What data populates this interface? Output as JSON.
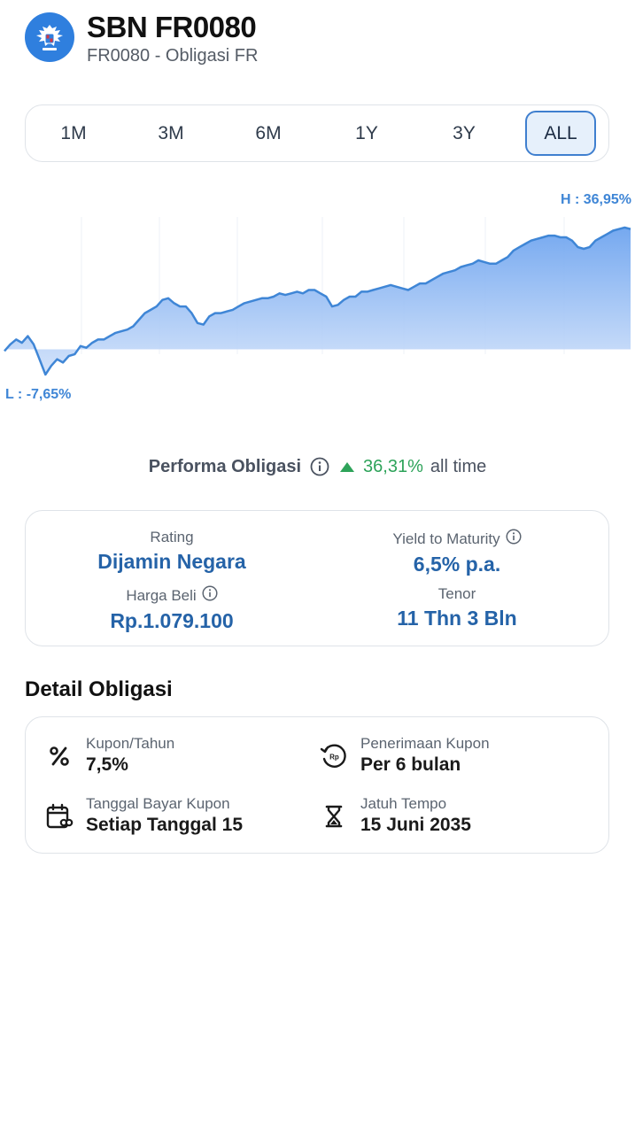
{
  "header": {
    "title": "SBN FR0080",
    "subtitle": "FR0080 - Obligasi FR",
    "logo_icon": "garuda-emblem-icon"
  },
  "timeframes": {
    "items": [
      "1M",
      "3M",
      "6M",
      "1Y",
      "3Y",
      "ALL"
    ],
    "selected": "ALL"
  },
  "chart_data": {
    "type": "area",
    "high_label": "H : 36,95%",
    "low_label": "L : -7,65%",
    "ylim": [
      -7.65,
      36.95
    ],
    "color": "#3f86d6",
    "values": [
      -0.5,
      1.5,
      3,
      2,
      4,
      1.5,
      -3,
      -7.65,
      -5,
      -3,
      -4,
      -2,
      -1.5,
      1,
      0.5,
      2,
      3,
      3,
      4,
      5,
      5.5,
      6,
      7,
      9,
      11,
      12,
      13,
      15,
      15.5,
      14,
      13,
      13,
      11,
      8,
      7.5,
      10,
      11,
      11,
      11.5,
      12,
      13,
      14,
      14.5,
      15,
      15.5,
      15.5,
      16,
      17,
      16.5,
      17,
      17.5,
      17,
      18,
      18,
      17,
      16,
      13,
      13.5,
      15,
      16,
      16,
      17.5,
      17.5,
      18,
      18.5,
      19,
      19.5,
      19,
      18.5,
      18,
      19,
      20,
      20,
      21,
      22,
      23,
      23.5,
      24,
      25,
      25.5,
      26,
      27,
      26.5,
      26,
      26,
      27,
      28,
      30,
      31,
      32,
      33,
      33.5,
      34,
      34.5,
      34.5,
      34,
      34,
      33,
      31,
      30.5,
      31,
      33,
      34,
      35,
      36,
      36.5,
      36.95,
      36.5
    ]
  },
  "performance": {
    "label": "Performa Obligasi",
    "value": "36,31%",
    "suffix": "all time",
    "trend": "up"
  },
  "summary": {
    "rating_label": "Rating",
    "rating_value": "Dijamin Negara",
    "ytm_label": "Yield to Maturity",
    "ytm_value": "6,5% p.a.",
    "price_label": "Harga Beli",
    "price_value": "Rp.1.079.100",
    "tenor_label": "Tenor",
    "tenor_value": "11 Thn 3 Bln"
  },
  "detail": {
    "section_title": "Detail Obligasi",
    "items": [
      {
        "label": "Kupon/Tahun",
        "value": "7,5%",
        "icon": "percent-icon"
      },
      {
        "label": "Penerimaan Kupon",
        "value": "Per 6 bulan",
        "icon": "coupon-cycle-icon"
      },
      {
        "label": "Tanggal Bayar Kupon",
        "value": "Setiap Tanggal 15",
        "icon": "calendar-icon"
      },
      {
        "label": "Jatuh Tempo",
        "value": "15 Juni 2035",
        "icon": "hourglass-icon"
      }
    ]
  }
}
